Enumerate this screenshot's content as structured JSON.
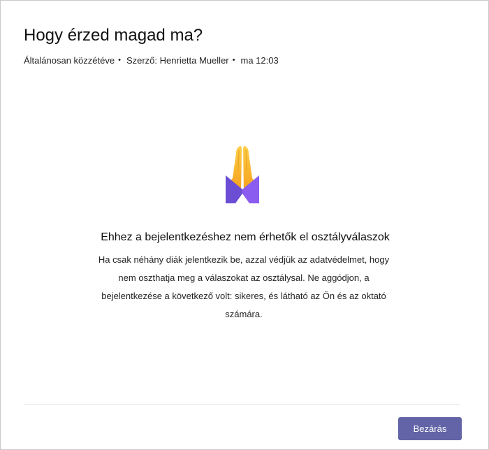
{
  "dialog": {
    "title": "Hogy érzed magad ma?",
    "meta": {
      "visibility": "Általánosan közzétéve",
      "author": "Szerző: Henrietta Mueller",
      "time": "ma 12:03",
      "separator": "•"
    },
    "illustration_icon": "praying-hands-icon",
    "empty_state": {
      "title": "Ehhez a bejelentkezéshez nem érhetők el osztályválaszok",
      "description": "Ha csak néhány diák jelentkezik be, azzal védjük az adatvédelmet, hogy nem oszthatja meg a válaszokat az osztálysal. Ne aggódjon, a bejelentkezése a következő volt: sikeres, és látható az Ön és az oktató számára."
    },
    "close_label": "Bezárás"
  },
  "colors": {
    "accent": "#6264a7",
    "hands_top": "#ffcf48",
    "hands_bottom": "#f59d1a",
    "cuff_left": "#6b4ed3",
    "cuff_right": "#8a5cf0"
  }
}
